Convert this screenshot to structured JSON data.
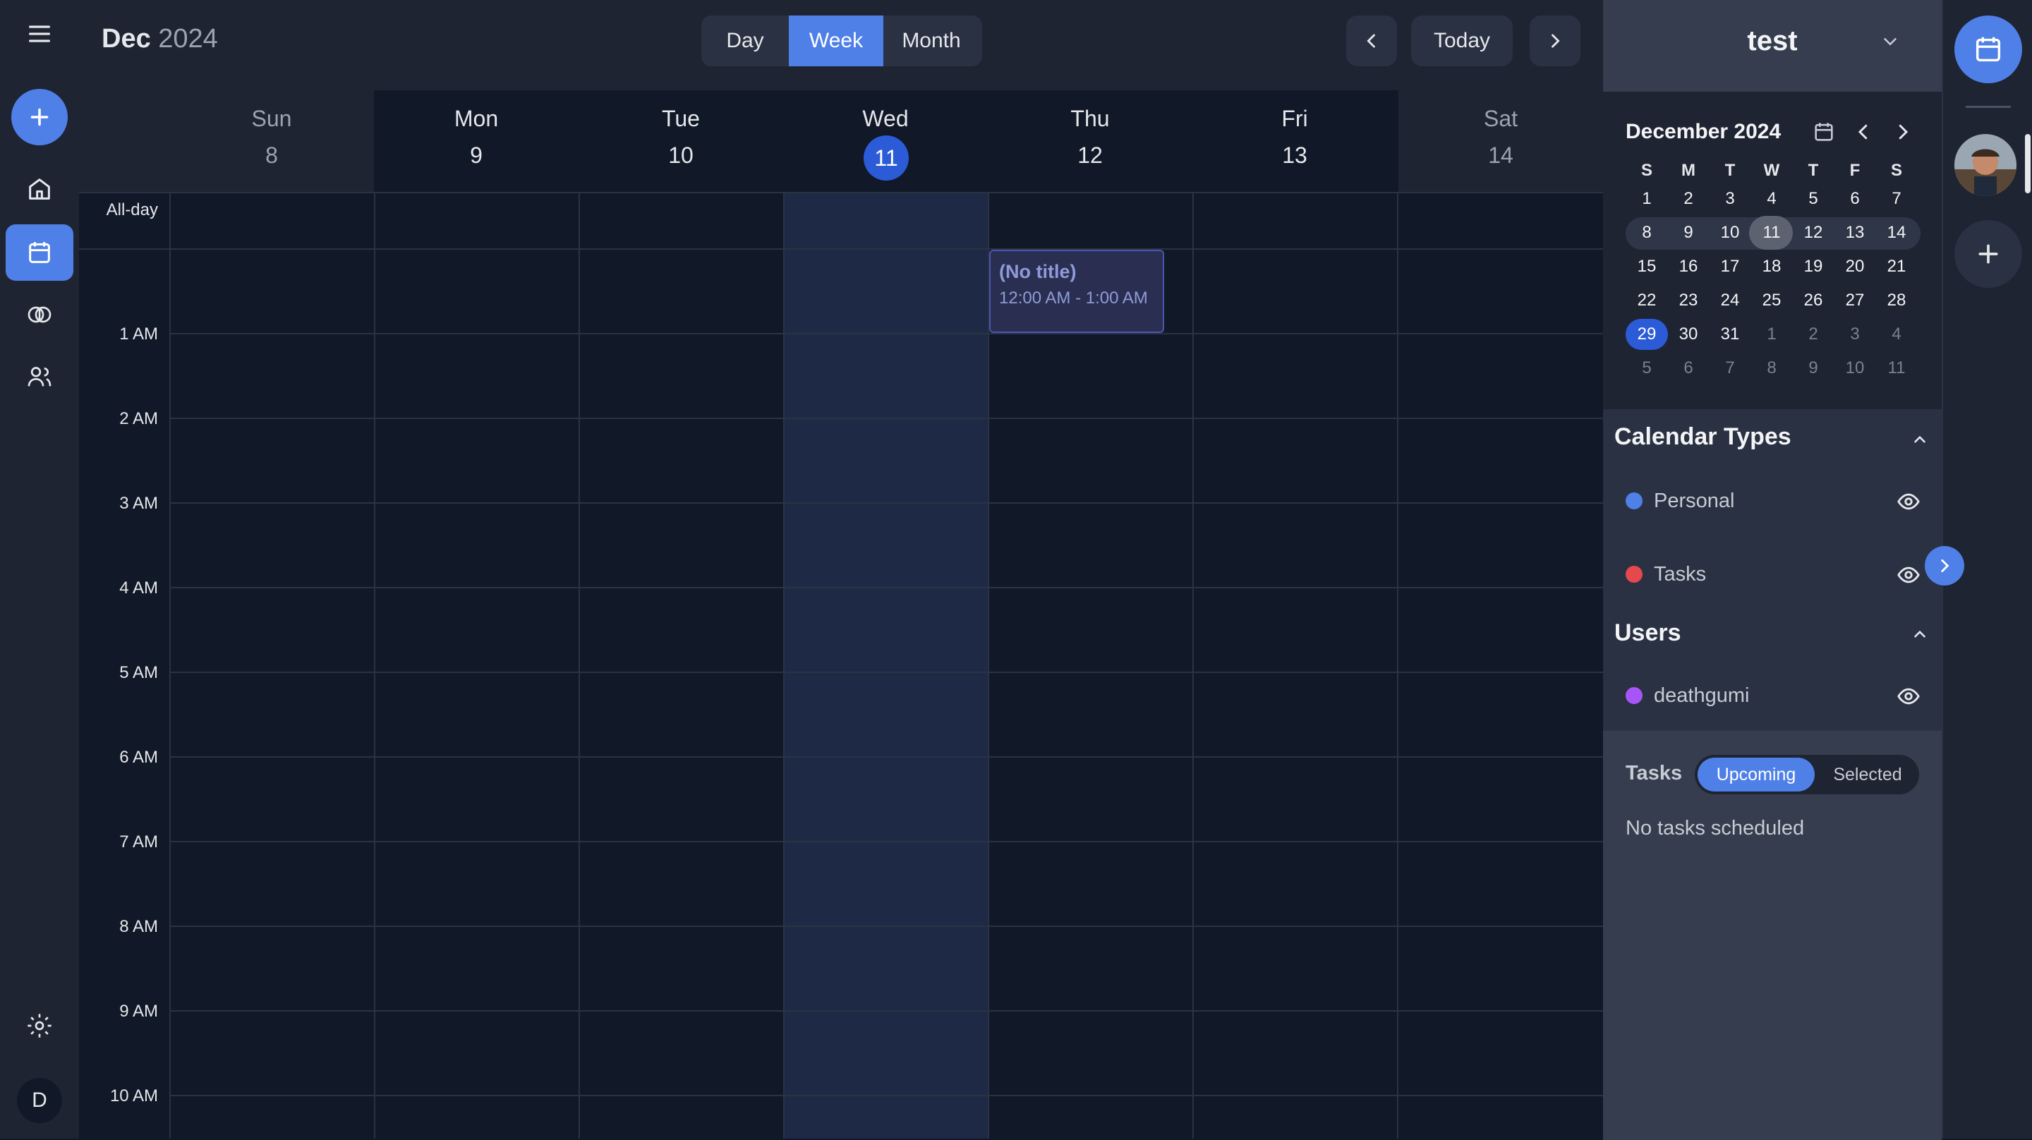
{
  "header": {
    "month": "Dec",
    "year": "2024",
    "views": [
      "Day",
      "Week",
      "Month"
    ],
    "active_view": "Week",
    "today_label": "Today"
  },
  "week": {
    "days": [
      {
        "name": "Sun",
        "num": "8"
      },
      {
        "name": "Mon",
        "num": "9"
      },
      {
        "name": "Tue",
        "num": "10"
      },
      {
        "name": "Wed",
        "num": "11"
      },
      {
        "name": "Thu",
        "num": "12"
      },
      {
        "name": "Fri",
        "num": "13"
      },
      {
        "name": "Sat",
        "num": "14"
      }
    ],
    "all_day_label": "All-day",
    "hours": [
      "1 AM",
      "2 AM",
      "3 AM",
      "4 AM",
      "5 AM",
      "6 AM",
      "7 AM",
      "8 AM",
      "9 AM",
      "10 AM"
    ]
  },
  "event": {
    "title": "(No title)",
    "time": "12:00 AM - 1:00 AM"
  },
  "sidebar": {
    "calendar_name": "test",
    "mini_month_title": "December 2024",
    "weekday_initials": [
      "S",
      "M",
      "T",
      "W",
      "T",
      "F",
      "S"
    ],
    "weeks": [
      [
        "1",
        "2",
        "3",
        "4",
        "5",
        "6",
        "7"
      ],
      [
        "8",
        "9",
        "10",
        "11",
        "12",
        "13",
        "14"
      ],
      [
        "15",
        "16",
        "17",
        "18",
        "19",
        "20",
        "21"
      ],
      [
        "22",
        "23",
        "24",
        "25",
        "26",
        "27",
        "28"
      ],
      [
        "29",
        "30",
        "31",
        "1",
        "2",
        "3",
        "4"
      ],
      [
        "5",
        "6",
        "7",
        "8",
        "9",
        "10",
        "11"
      ]
    ],
    "calendar_types_title": "Calendar Types",
    "calendar_types": [
      {
        "label": "Personal",
        "color": "#4f80e8"
      },
      {
        "label": "Tasks",
        "color": "#e5484d"
      }
    ],
    "users_title": "Users",
    "users": [
      {
        "label": "deathgumi",
        "color": "#a855f7"
      }
    ],
    "tasks_title": "Tasks",
    "task_tabs": [
      "Upcoming",
      "Selected"
    ],
    "tasks_empty": "No tasks scheduled"
  },
  "nav": {
    "avatar_letter": "D"
  },
  "colors": {
    "accent": "#4f80e8",
    "today": "#2b5bd7",
    "today_col": "#1e2a45"
  }
}
